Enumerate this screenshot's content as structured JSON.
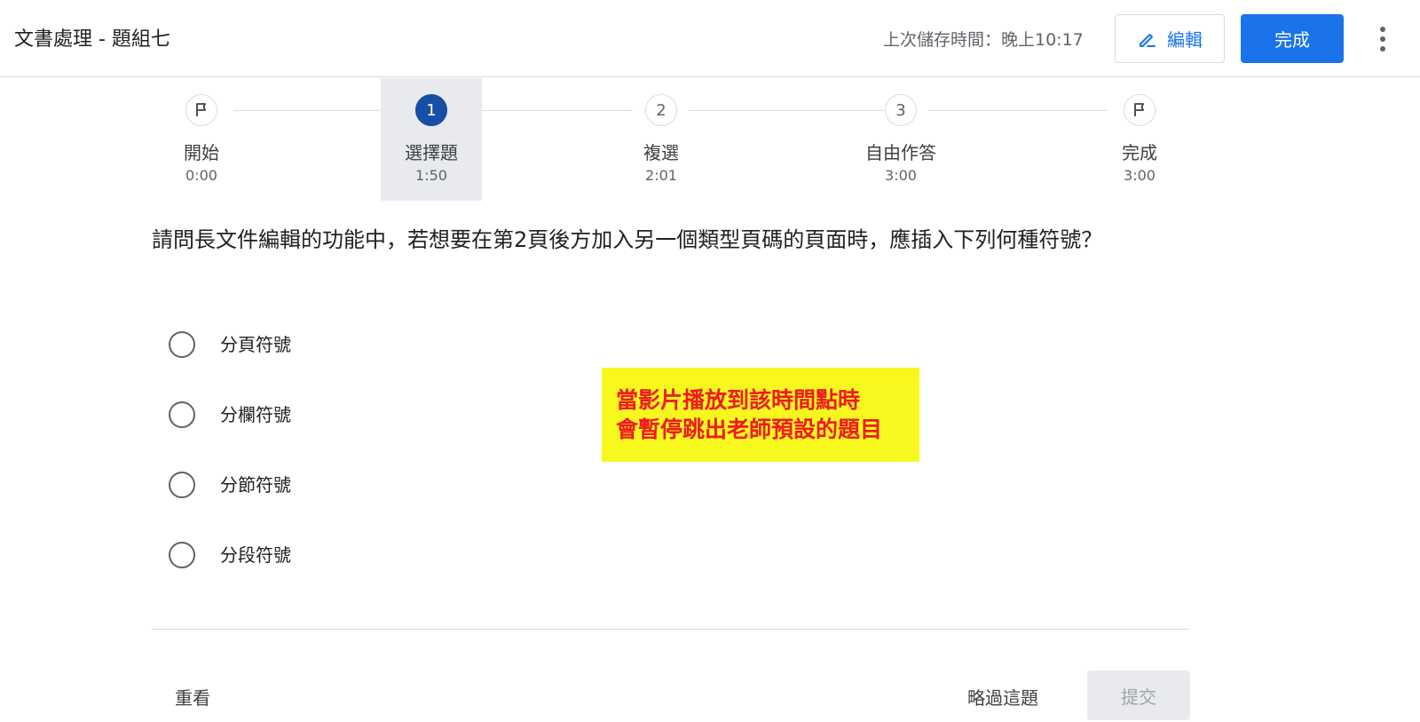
{
  "header": {
    "title": "文書處理 - 題組七",
    "saved_status": "上次儲存時間：晚上10:17",
    "edit_label": "編輯",
    "done_label": "完成"
  },
  "stepper": {
    "steps": [
      {
        "label": "開始",
        "time": "0:00",
        "icon": "flag-icon"
      },
      {
        "label": "選擇題",
        "time": "1:50",
        "number": "1",
        "active": true
      },
      {
        "label": "複選",
        "time": "2:01",
        "number": "2"
      },
      {
        "label": "自由作答",
        "time": "3:00",
        "number": "3"
      },
      {
        "label": "完成",
        "time": "3:00",
        "icon": "flag-icon"
      }
    ]
  },
  "question": {
    "text": "請問長文件編輯的功能中，若想要在第2頁後方加入另一個類型頁碼的頁面時，應插入下列何種符號？",
    "options": [
      "分頁符號",
      "分欄符號",
      "分節符號",
      "分段符號"
    ]
  },
  "note": {
    "line1": "當影片播放到該時間點時",
    "line2": "會暫停跳出老師預設的題目",
    "background": "#f8f81e",
    "color": "#ee1c1c"
  },
  "footer": {
    "review_label": "重看",
    "skip_label": "略過這題",
    "submit_label": "提交"
  },
  "colors": {
    "accent": "#1a73e8",
    "active_step": "#174ea6"
  }
}
